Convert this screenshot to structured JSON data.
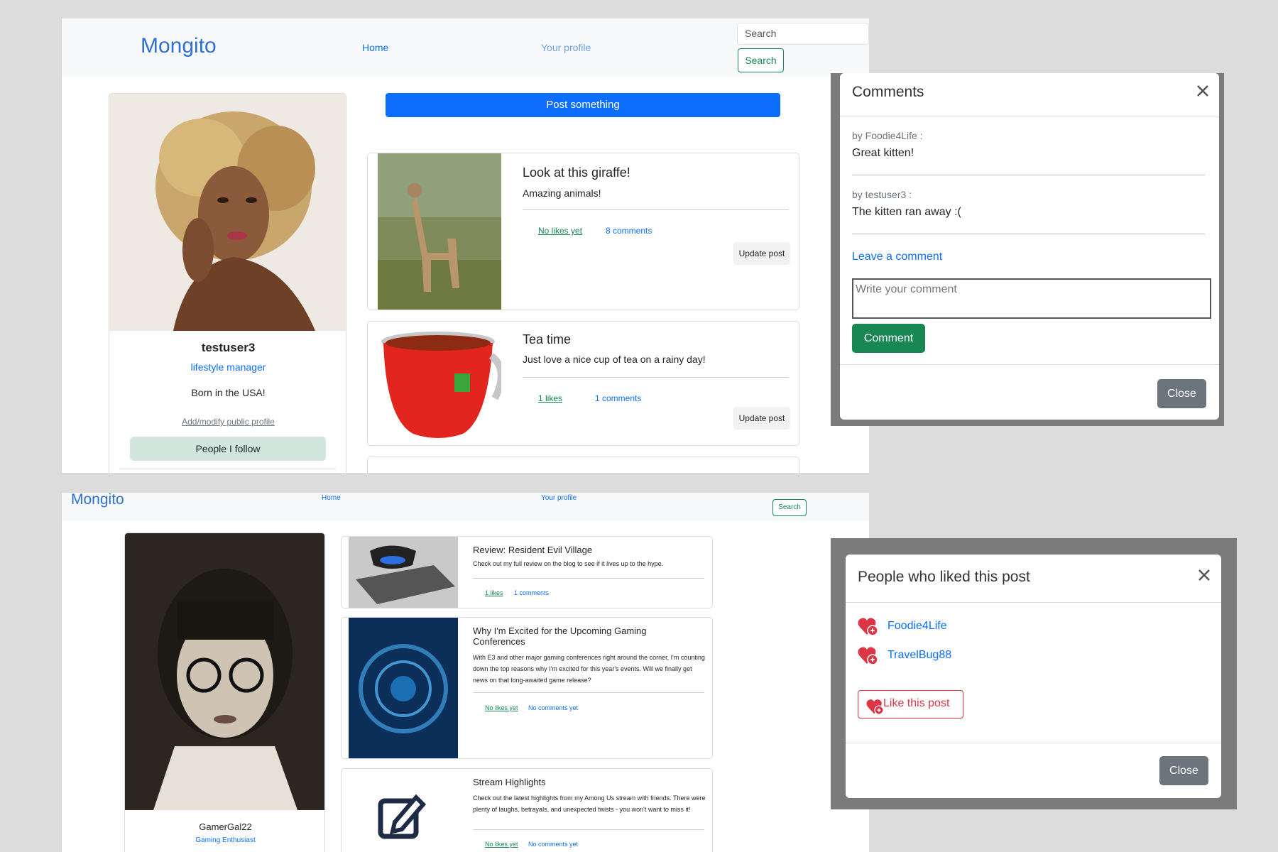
{
  "top": {
    "nav": {
      "brand": "Mongito",
      "home": "Home",
      "profile": "Your profile",
      "search_placeholder": "Search",
      "search_button": "Search"
    },
    "post_button": "Post something",
    "profile_card": {
      "username": "testuser3",
      "role": "lifestyle manager",
      "bio": "Born in the USA!",
      "modify_link": "Add/modify public profile",
      "follow_button": "People I follow"
    },
    "posts": [
      {
        "title": "Look at this giraffe!",
        "body": "Amazing animals!",
        "likes": "No likes yet",
        "comments": "8 comments",
        "update": "Update post"
      },
      {
        "title": "Tea time",
        "body": "Just love a nice cup of tea on a rainy day!",
        "likes": "1 likes",
        "comments": "1 comments",
        "update": "Update post"
      }
    ]
  },
  "bottom": {
    "nav": {
      "brand": "Mongito",
      "home": "Home",
      "profile": "Your profile",
      "search_button": "Search"
    },
    "profile_card": {
      "username": "GamerGal22",
      "role": "Gaming Enthusiast"
    },
    "posts": [
      {
        "title": "Review: Resident Evil Village",
        "body": "Check out my full review on the blog to see if it lives up to the hype.",
        "likes": "1 likes",
        "comments": "1 comments"
      },
      {
        "title": "Why I'm Excited for the Upcoming Gaming Conferences",
        "body": "With E3 and other major gaming conferences right around the corner, I'm counting down the top reasons why I'm excited for this year's events. Will we finally get news on that long-awaited game release?",
        "likes": "No likes yet",
        "comments": "No comments yet"
      },
      {
        "title": "Stream Highlights",
        "body": "Check out the latest highlights from my Among Us stream with friends. There were plenty of laughs, betrayals, and unexpected twists - you won't want to miss it!",
        "likes": "No likes yet",
        "comments": "No comments yet"
      }
    ]
  },
  "comments_modal": {
    "title": "Comments",
    "comments": [
      {
        "author": "by Foodie4Life :",
        "text": "Great kitten!"
      },
      {
        "author": "by testuser3 :",
        "text": "The kitten ran away :("
      }
    ],
    "leave_label": "Leave a comment",
    "placeholder": "Write your comment",
    "submit": "Comment",
    "close": "Close"
  },
  "likes_modal": {
    "title": "People who liked this post",
    "users": [
      "Foodie4Life",
      "TravelBug88"
    ],
    "like_button": "Like this post",
    "close": "Close"
  },
  "colors": {
    "primary": "#0d6efd",
    "success": "#198754",
    "heart": "#dc3545",
    "secondary": "#6c757d"
  }
}
